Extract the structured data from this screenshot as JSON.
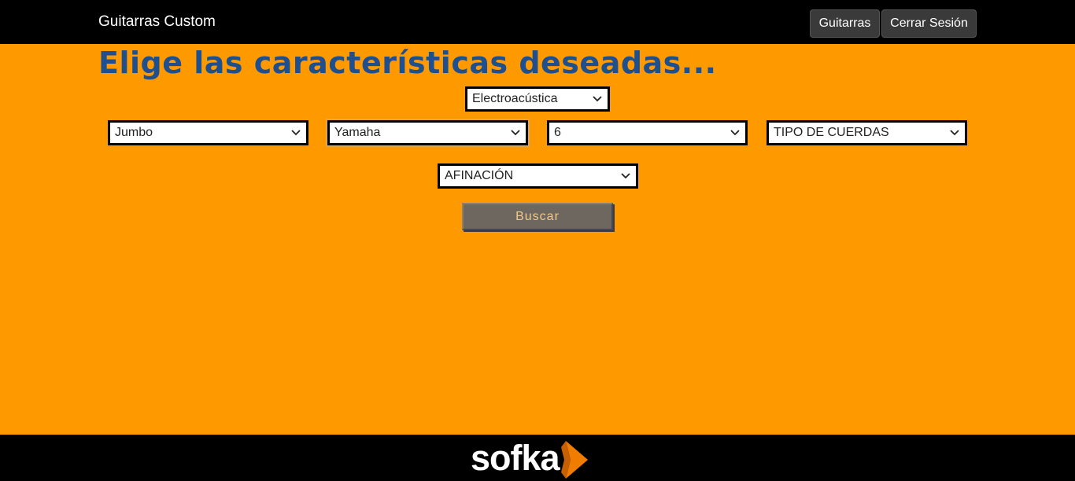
{
  "header": {
    "brand": "Guitarras Custom",
    "nav": {
      "guitarras": "Guitarras",
      "logout": "Cerrar Sesión"
    }
  },
  "main": {
    "title": "Elige las características deseadas...",
    "selects": {
      "type": "Electroacústica",
      "body": "Jumbo",
      "brand": "Yamaha",
      "strings_count": "6",
      "string_type": "TIPO DE CUERDAS",
      "tuning": "AFINACIÓN"
    },
    "search_button": "Buscar"
  },
  "footer": {
    "logo": "sofka"
  },
  "colors": {
    "background": "#ff9900",
    "bar": "#000000",
    "title": "#1e4f8f",
    "button": "#6e6760",
    "logo_accent": "#f07d00"
  }
}
